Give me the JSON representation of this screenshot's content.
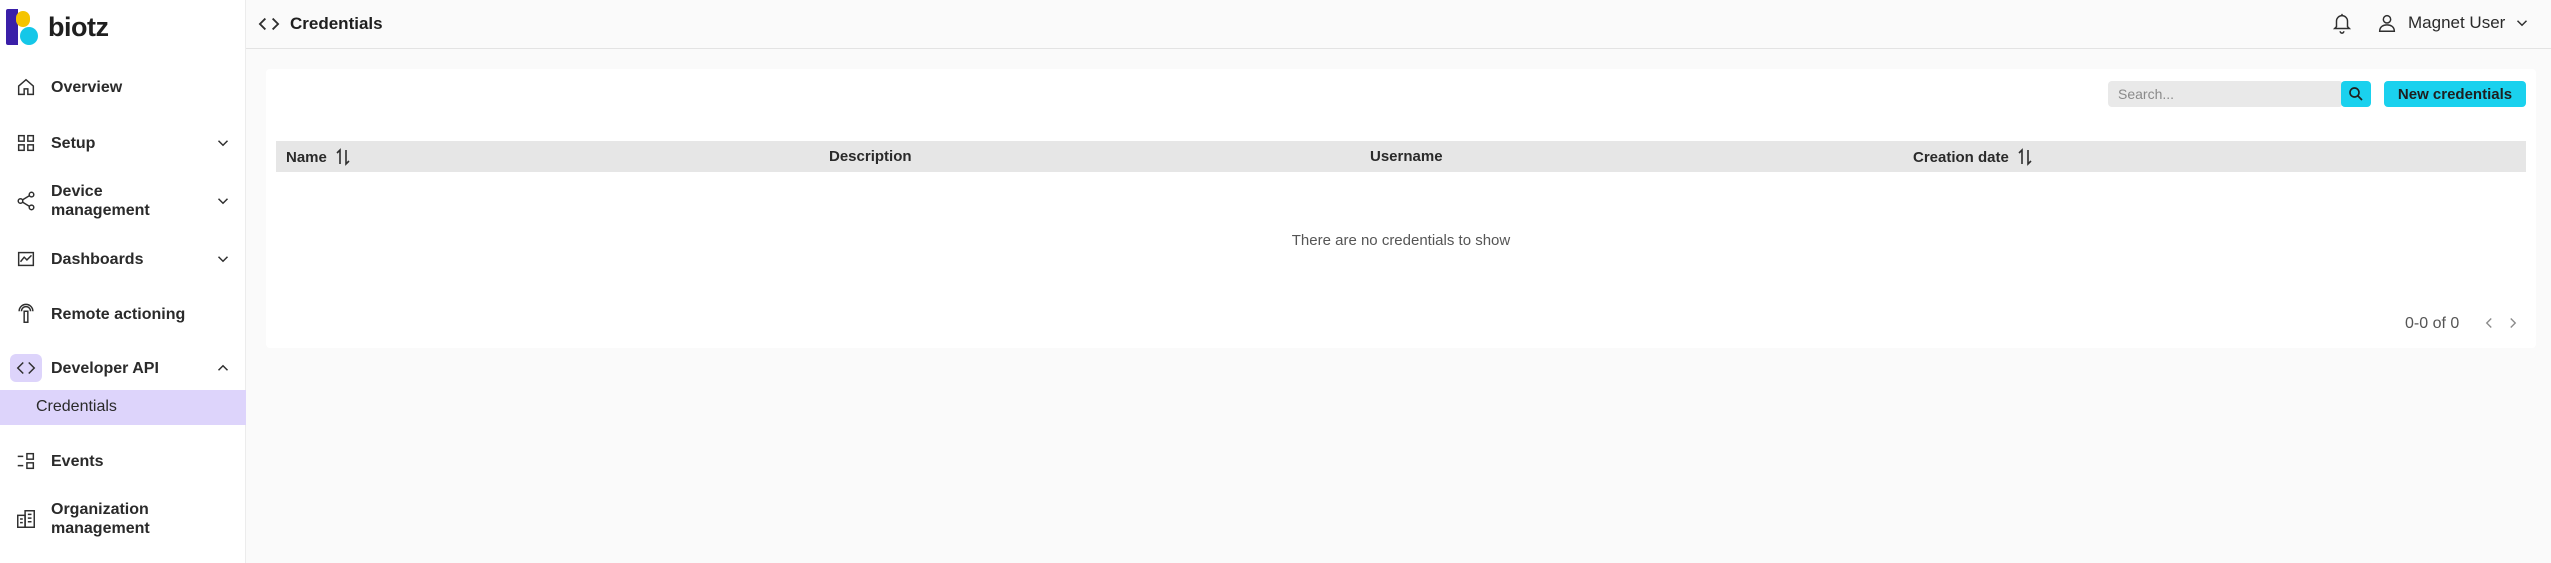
{
  "app": {
    "logo_text": "biotz"
  },
  "sidebar": {
    "items": [
      {
        "label": "Overview",
        "icon": "home-icon"
      },
      {
        "label": "Setup",
        "icon": "grid-icon",
        "expandable": true,
        "expanded": false
      },
      {
        "label_line1": "Device",
        "label_line2": "management",
        "icon": "share-nodes-icon",
        "expandable": true,
        "expanded": false
      },
      {
        "label": "Dashboards",
        "icon": "chart-icon",
        "expandable": true,
        "expanded": false
      },
      {
        "label": "Remote actioning",
        "icon": "antenna-icon"
      },
      {
        "label": "Developer API",
        "icon": "code-icon",
        "expandable": true,
        "expanded": true,
        "active": true
      },
      {
        "label": "Events",
        "icon": "events-icon"
      },
      {
        "label_line1": "Organization",
        "label_line2": "management",
        "icon": "building-icon"
      }
    ],
    "subitem_active": "Credentials"
  },
  "header": {
    "title": "Credentials",
    "user_name": "Magnet User"
  },
  "toolbar": {
    "search_placeholder": "Search...",
    "new_button_label": "New credentials"
  },
  "table": {
    "columns": [
      {
        "label": "Name",
        "sortable": true
      },
      {
        "label": "Description",
        "sortable": false
      },
      {
        "label": "Username",
        "sortable": false
      },
      {
        "label": "Creation date",
        "sortable": true
      }
    ],
    "rows": [],
    "empty_text": "There are no credentials to show"
  },
  "pagination": {
    "summary": "0-0 of 0"
  },
  "colors": {
    "accent": "#1ad1ee",
    "active_nav": "#ddd4fb",
    "logo_purple": "#3a1fa8",
    "logo_yellow": "#f5c400",
    "logo_cyan": "#15c7e8"
  }
}
